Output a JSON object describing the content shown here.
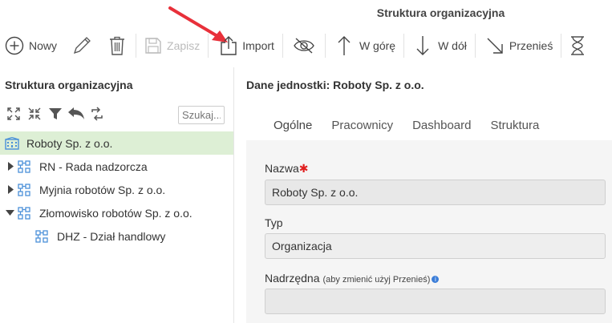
{
  "app": {
    "title": "Struktura organizacyjna"
  },
  "toolbar": {
    "new_label": "Nowy",
    "save_label": "Zapisz",
    "import_label": "Import",
    "up_label": "W górę",
    "down_label": "W dół",
    "move_label": "Przenieś"
  },
  "left": {
    "title": "Struktura organizacyjna",
    "search_placeholder": "Szukaj...",
    "tree": [
      {
        "label": "Roboty Sp. z o.o.",
        "selected": true
      },
      {
        "label": "RN - Rada nadzorcza",
        "expanded": false
      },
      {
        "label": "Myjnia robotów Sp. z o.o.",
        "expanded": false
      },
      {
        "label": "Złomowisko robotów Sp. z o.o.",
        "expanded": true
      },
      {
        "label": "DHZ - Dział handlowy"
      }
    ]
  },
  "right": {
    "title": "Dane jednostki: Roboty Sp. z o.o.",
    "tabs": [
      "Ogólne",
      "Pracownicy",
      "Dashboard",
      "Struktura"
    ],
    "active_tab": "Ogólne",
    "fields": {
      "name_label": "Nazwa",
      "name_value": "Roboty Sp. z o.o.",
      "type_label": "Typ",
      "type_value": "Organizacja",
      "parent_label": "Nadrzędna",
      "parent_hint": "(aby zmienić użyj Przenieś)",
      "parent_value": ""
    }
  },
  "colors": {
    "accent": "#7cb82f",
    "selected_row": "#ddefd5",
    "required": "#e02020",
    "annotation_arrow": "#e8303a",
    "tree_icon": "#4a90d9"
  }
}
